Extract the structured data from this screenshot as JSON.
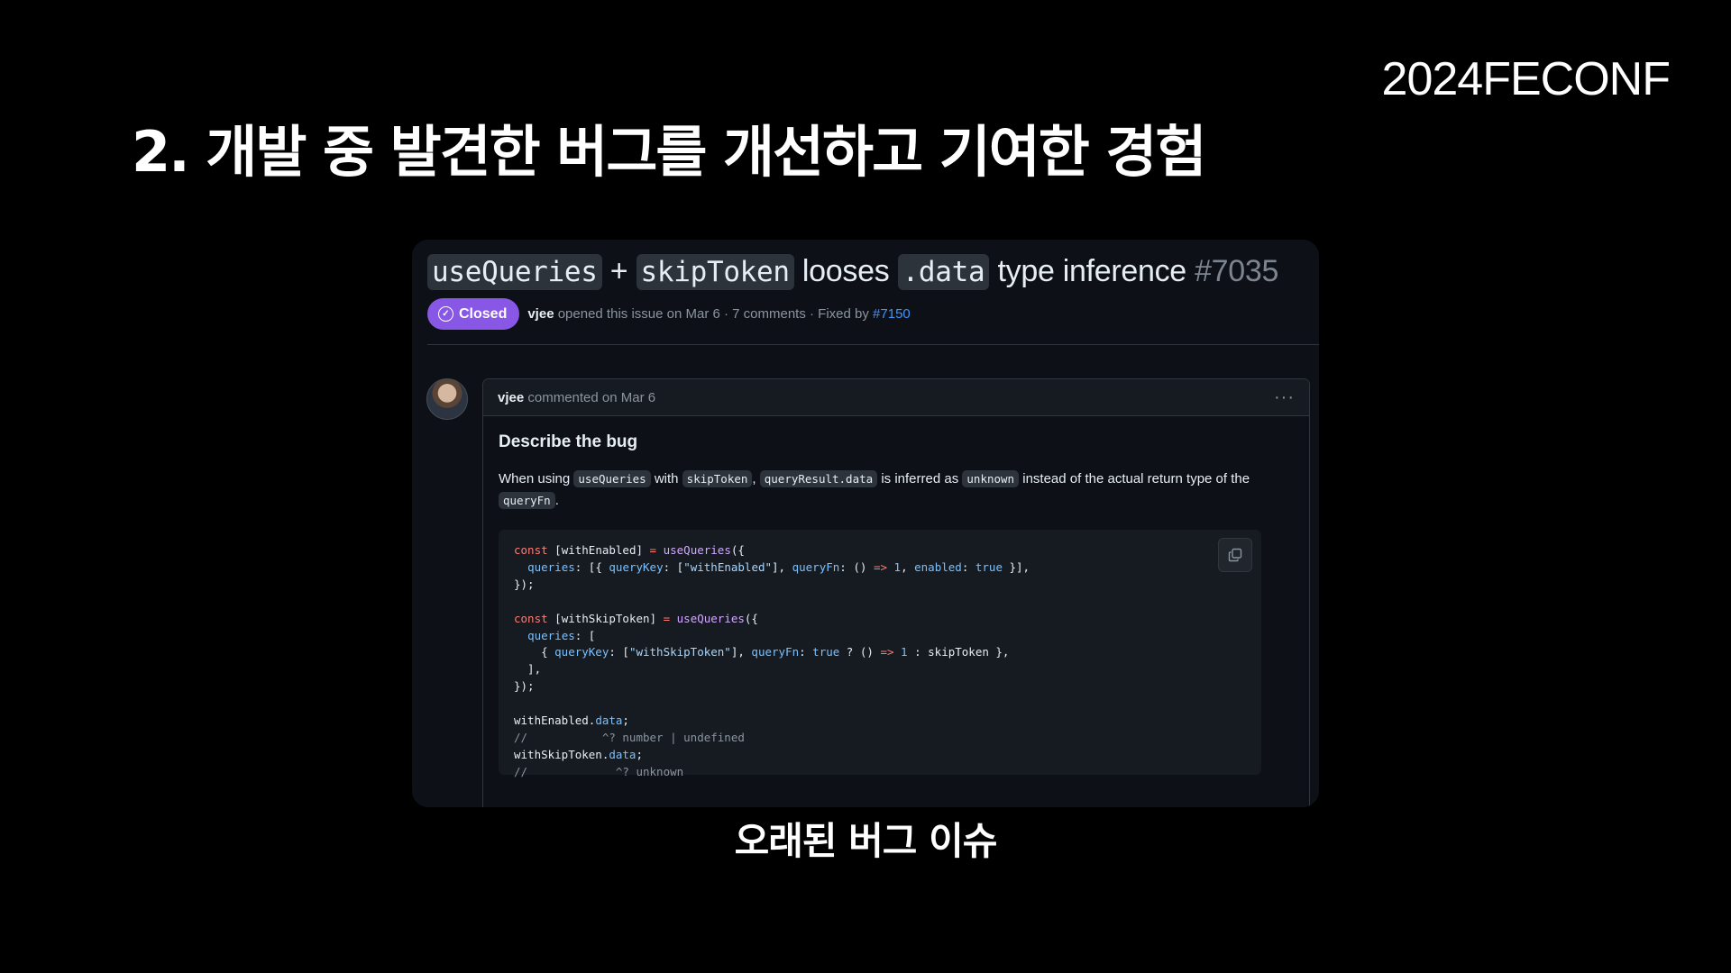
{
  "slide": {
    "logo": "2024FECONF",
    "title": "2. 개발 중 발견한 버그를 개선하고 기여한 경험",
    "caption": "오래된 버그 이슈"
  },
  "issue": {
    "title_code_1": "useQueries",
    "title_plus": " + ",
    "title_code_2": "skipToken",
    "title_text_1": " looses ",
    "title_code_3": ".data",
    "title_text_2": " type inference ",
    "number": "#7035",
    "status": "Closed",
    "status_color": "#8957e5",
    "author": "vjee",
    "meta": " opened this issue on Mar 6 · 7 comments · Fixed by ",
    "fixed_by": "#7150"
  },
  "comment": {
    "author": "vjee",
    "meta": " commented on Mar 6",
    "heading": "Describe the bug",
    "desc_1": "When using ",
    "code_1": "useQueries",
    "desc_2": " with ",
    "code_2": "skipToken",
    "desc_3": ", ",
    "code_3": "queryResult.data",
    "desc_4": " is inferred as ",
    "code_4": "unknown",
    "desc_5": " instead of the actual return type of the ",
    "code_5": "queryFn",
    "desc_6": ".",
    "code_block": {
      "l1_kw": "const",
      "l1_a": " [withEnabled] ",
      "l1_op": "=",
      "l1_sp": " ",
      "l1_fn": "useQueries",
      "l1_b": "({",
      "l2_pre": "  ",
      "l2_k1": "queries",
      "l2_a": ": [{ ",
      "l2_k2": "queryKey",
      "l2_b": ": [",
      "l2_s": "\"withEnabled\"",
      "l2_c": "], ",
      "l2_k3": "queryFn",
      "l2_d": ": () ",
      "l2_op": "=>",
      "l2_sp": " ",
      "l2_n": "1",
      "l2_e": ", ",
      "l2_k4": "enabled",
      "l2_f": ": ",
      "l2_t": "true",
      "l2_g": " }],",
      "l3": "});",
      "l5_kw": "const",
      "l5_a": " [withSkipToken] ",
      "l5_op": "=",
      "l5_sp": " ",
      "l5_fn": "useQueries",
      "l5_b": "({",
      "l6_pre": "  ",
      "l6_k": "queries",
      "l6_a": ": [",
      "l7_pre": "    { ",
      "l7_k1": "queryKey",
      "l7_a": ": [",
      "l7_s": "\"withSkipToken\"",
      "l7_b": "], ",
      "l7_k2": "queryFn",
      "l7_c": ": ",
      "l7_t": "true",
      "l7_d": " ? () ",
      "l7_op": "=>",
      "l7_sp": " ",
      "l7_n": "1",
      "l7_e": " : skipToken },",
      "l8": "  ],",
      "l9": "});",
      "l11_a": "withEnabled.",
      "l11_p": "data",
      "l11_b": ";",
      "l12": "//           ^? number | undefined",
      "l13_a": "withSkipToken.",
      "l13_p": "data",
      "l13_b": ";",
      "l14": "//             ^? unknown"
    }
  }
}
